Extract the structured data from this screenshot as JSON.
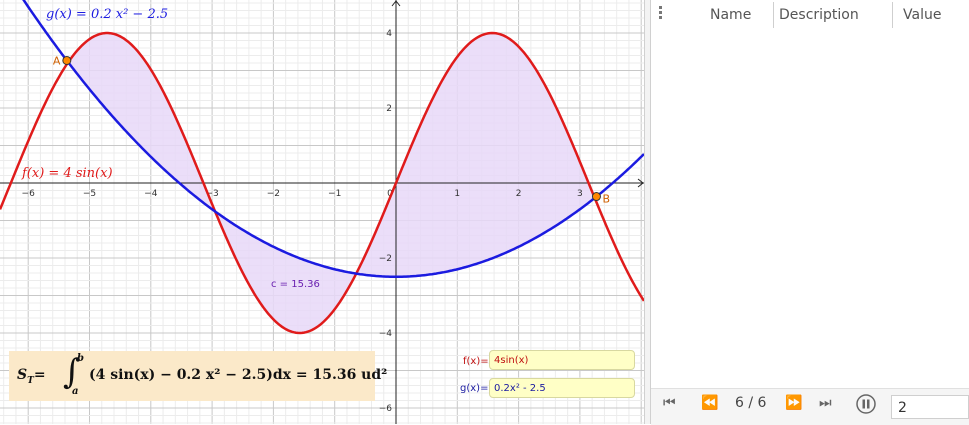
{
  "graph": {
    "x_ticks": [
      "−6",
      "−5",
      "−4",
      "−3",
      "−2",
      "−1",
      "0",
      "1",
      "2",
      "3"
    ],
    "y_ticks": [
      "4",
      "2",
      "−2",
      "−4",
      "−6"
    ],
    "g_label": "g(x)  =  0.2 x² − 2.5",
    "f_label": "f(x)  =  4 sin(x)",
    "point_a": "A",
    "point_b": "B",
    "area_label": "c = 15.36",
    "colors": {
      "f": "#e01b1b",
      "g": "#1b1be0",
      "fill": "#e8d8f8",
      "point": "#ff8800",
      "eq_bg": "#fbe9c9",
      "input_bg": "#ffffc6"
    }
  },
  "equation": {
    "lhs": "S",
    "lhs_sub": "T",
    "equals": "=",
    "upper": "b",
    "lower": "a",
    "integrand": "(4 sin(x) − 0.2 x² − 2.5)dx = 15.36 ud²"
  },
  "inputs": {
    "f_prefix": "f(x)=",
    "f_value": "4sin(x)",
    "g_prefix": "g(x)=",
    "g_value": "0.2x² - 2.5"
  },
  "table": {
    "columns": [
      "Name",
      "Description",
      "Value"
    ]
  },
  "playbar": {
    "step": "6 / 6",
    "speed_value": "2"
  }
}
